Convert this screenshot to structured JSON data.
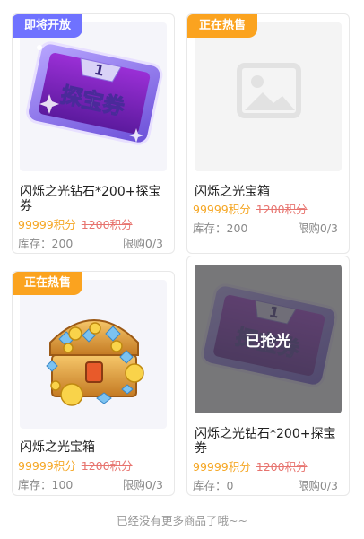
{
  "products": [
    {
      "badge": "即将开放",
      "title": "闪烁之光钻石*200+探宝券",
      "price": "99999积分",
      "original_price": "1200积分",
      "stock": "库存：200",
      "limit": "限购0/3",
      "image": "treasure-ticket",
      "sold_out": false
    },
    {
      "badge": "正在热售",
      "title": "闪烁之光宝箱",
      "price": "99999积分",
      "original_price": "1200积分",
      "stock": "库存：200",
      "limit": "限购0/3",
      "image": "image-placeholder",
      "sold_out": false
    },
    {
      "badge": "正在热售",
      "title": "闪烁之光宝箱",
      "price": "99999积分",
      "original_price": "1200积分",
      "stock": "库存：100",
      "limit": "限购0/3",
      "image": "treasure-chest",
      "sold_out": false
    },
    {
      "badge": "",
      "title": "闪烁之光钻石*200+探宝券",
      "price": "99999积分",
      "original_price": "1200积分",
      "stock": "库存：0",
      "limit": "限购0/3",
      "image": "treasure-ticket",
      "sold_out": true,
      "sold_out_label": "已抢光"
    }
  ],
  "ticket_text": {
    "number": "1",
    "label": "探宝券"
  },
  "footer_text": "已经没有更多商品了哦~~",
  "colors": {
    "badge_upcoming": "#6f72ff",
    "badge_hot": "#fba31f",
    "price": "#f5a623",
    "original_price": "#e0463f",
    "muted": "#8a8a8a"
  }
}
